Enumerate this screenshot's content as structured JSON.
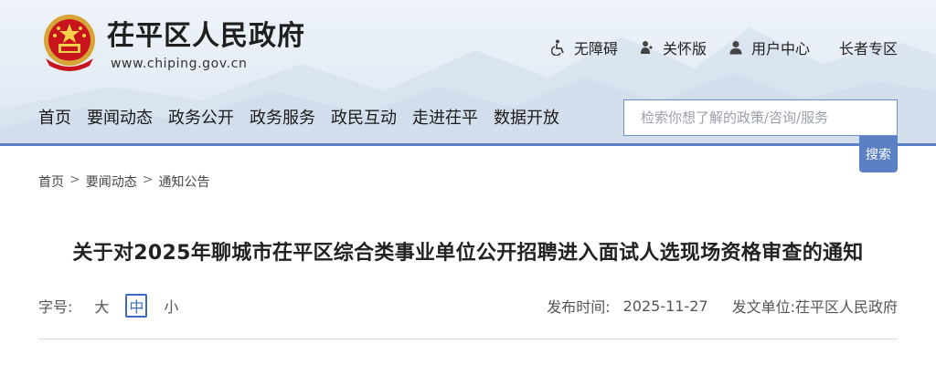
{
  "site": {
    "title": "茌平区人民政府",
    "url": "www.chiping.gov.cn"
  },
  "top_links": [
    {
      "label": "无障碍",
      "icon": "accessibility-icon"
    },
    {
      "label": "关怀版",
      "icon": "care-icon"
    },
    {
      "label": "用户中心",
      "icon": "user-icon"
    },
    {
      "label": "长者专区",
      "icon": ""
    }
  ],
  "nav": {
    "items": [
      "首页",
      "要闻动态",
      "政务公开",
      "政务服务",
      "政民互动",
      "走进茌平",
      "数据开放"
    ]
  },
  "search": {
    "placeholder": "检索你想了解的政策/咨询/服务",
    "button_label": "搜索"
  },
  "breadcrumb": {
    "items": [
      "首页",
      "要闻动态",
      "通知公告"
    ],
    "separator": ">"
  },
  "article": {
    "title": "关于对2025年聊城市茌平区综合类事业单位公开招聘进入面试人选现场资格审查的通知",
    "font_size_label": "字号:",
    "font_sizes": [
      "大",
      "中",
      "小"
    ],
    "active_font_size": "中",
    "publish_label": "发布时间:",
    "publish_date": "2025-11-27",
    "issuer": "发文单位:茌平区人民政府"
  },
  "colors": {
    "accent": "#5b7fc4",
    "active_font": "#3a6bc0",
    "header_bg": "#e4ecf5"
  }
}
